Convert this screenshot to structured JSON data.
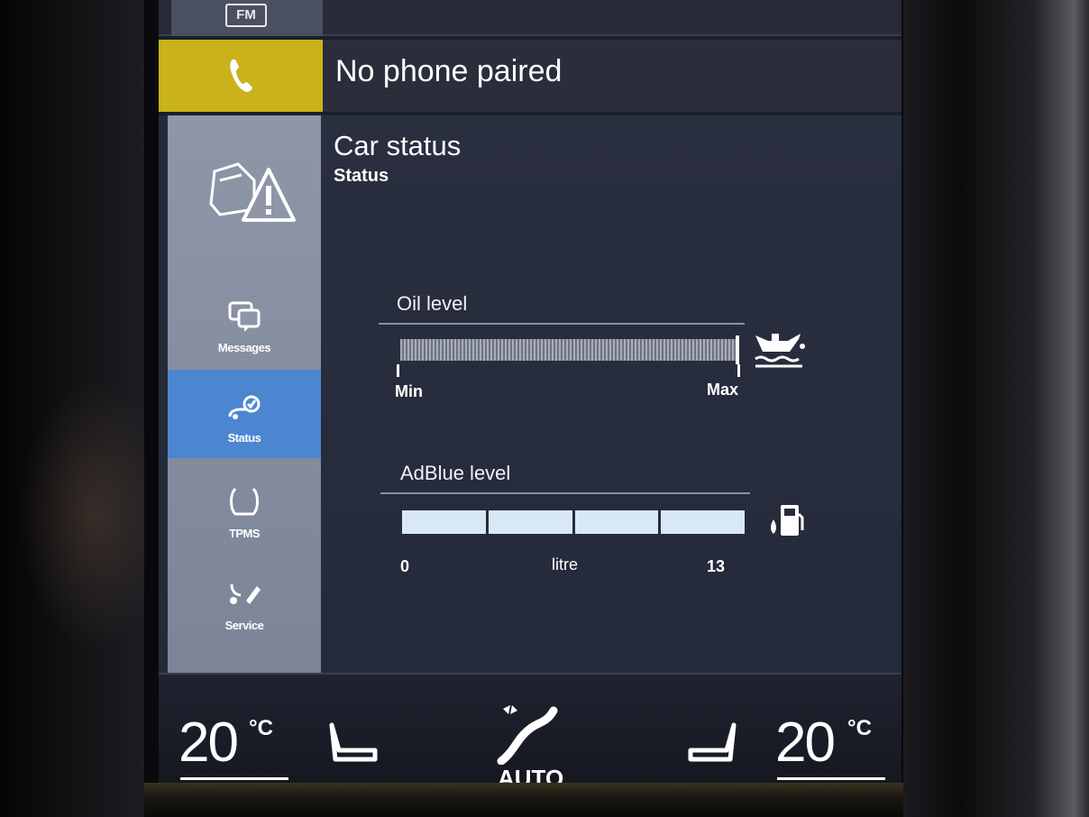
{
  "top_row": {
    "source_badge": "FM"
  },
  "phone": {
    "status_text": "No phone paired"
  },
  "app": {
    "title": "Car status",
    "subtitle": "Status"
  },
  "sidebar": {
    "items": [
      {
        "label": "Messages",
        "icon": "messages-icon",
        "active": false
      },
      {
        "label": "Status",
        "icon": "car-status-icon",
        "active": true
      },
      {
        "label": "TPMS",
        "icon": "tpms-icon",
        "active": false
      },
      {
        "label": "Service",
        "icon": "service-icon",
        "active": false
      }
    ]
  },
  "oil": {
    "label": "Oil level",
    "min_label": "Min",
    "max_label": "Max",
    "level_fraction": 1.0,
    "icon": "oil-can-icon"
  },
  "adblue": {
    "label": "AdBlue level",
    "min_value": "0",
    "unit": "litre",
    "max_value": "13",
    "level_fraction": 1.0,
    "segments": 4,
    "icon": "adblue-pump-icon"
  },
  "climate": {
    "left_temp": "20",
    "left_unit": "°C",
    "right_temp": "20",
    "right_unit": "°C",
    "fan_mode": "AUTO"
  },
  "colors": {
    "phone_tile": "#c9b21a",
    "active_item": "#4c86d0",
    "sidebar": "#8e96a8",
    "content_bg": "#262b3a"
  }
}
